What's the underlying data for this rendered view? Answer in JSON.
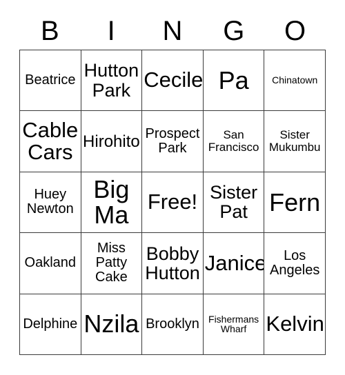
{
  "card": {
    "title": "BINGO",
    "header_letters": [
      "B",
      "I",
      "N",
      "G",
      "O"
    ],
    "free_space_label": "Free!",
    "colors": {
      "text": "#000000",
      "grid_line": "#3a3a3a",
      "background": "#ffffff"
    },
    "rows": [
      [
        {
          "text": "Beatrice",
          "size": "fs-md"
        },
        {
          "text": "Hutton Park",
          "size": "fs-xl"
        },
        {
          "text": "Cecile",
          "size": "fs-xxl"
        },
        {
          "text": "Pa",
          "size": "fs-huge"
        },
        {
          "text": "Chinatown",
          "size": "fs-xs"
        }
      ],
      [
        {
          "text": "Cable Cars",
          "size": "fs-xxl"
        },
        {
          "text": "Hirohito",
          "size": "fs-lg"
        },
        {
          "text": "Prospect Park",
          "size": "fs-md"
        },
        {
          "text": "San Francisco",
          "size": "fs-sm"
        },
        {
          "text": "Sister Mukumbu",
          "size": "fs-sm"
        }
      ],
      [
        {
          "text": "Huey Newton",
          "size": "fs-md"
        },
        {
          "text": "Big Ma",
          "size": "fs-huge"
        },
        {
          "text": "Free!",
          "size": "fs-xxl"
        },
        {
          "text": "Sister Pat",
          "size": "fs-xl"
        },
        {
          "text": "Fern",
          "size": "fs-huge"
        }
      ],
      [
        {
          "text": "Oakland",
          "size": "fs-md"
        },
        {
          "text": "Miss Patty Cake",
          "size": "fs-md"
        },
        {
          "text": "Bobby Hutton",
          "size": "fs-xl"
        },
        {
          "text": "Janice",
          "size": "fs-xxl"
        },
        {
          "text": "Los Angeles",
          "size": "fs-md"
        }
      ],
      [
        {
          "text": "Delphine",
          "size": "fs-md"
        },
        {
          "text": "Nzila",
          "size": "fs-huge"
        },
        {
          "text": "Brooklyn",
          "size": "fs-md"
        },
        {
          "text": "Fishermans Wharf",
          "size": "fs-xs"
        },
        {
          "text": "Kelvin",
          "size": "fs-xxl"
        }
      ]
    ]
  }
}
